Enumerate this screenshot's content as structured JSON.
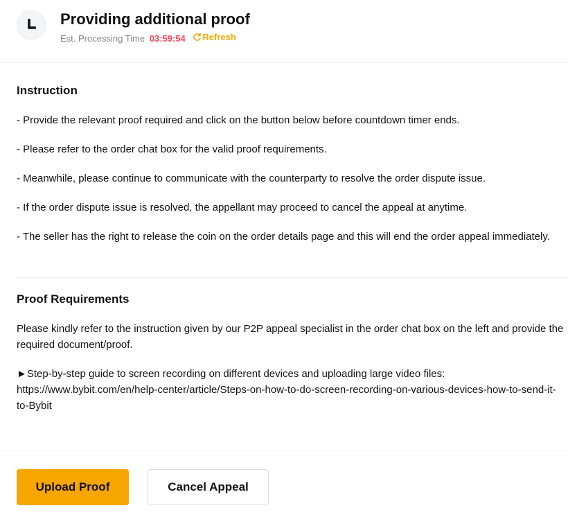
{
  "header": {
    "title": "Providing additional proof",
    "processing_label": "Est. Processing Time",
    "timer": "03:59:54",
    "refresh_label": "Refresh",
    "clock_icon": "clock-icon",
    "refresh_icon": "refresh-icon"
  },
  "instruction": {
    "title": "Instruction",
    "items": [
      "- Provide the relevant proof required and click on the button below before countdown timer ends.",
      "- Please refer to the order chat box for the valid proof requirements.",
      "- Meanwhile, please continue to communicate with the counterparty to resolve the order dispute issue.",
      "- If the order dispute issue is resolved, the appellant may proceed to cancel the appeal at anytime.",
      "- The seller has the right to release the coin on the order details page and this will end the order appeal immediately."
    ]
  },
  "proof": {
    "title": "Proof Requirements",
    "text": "Please kindly refer to the instruction given by our P2P appeal specialist in the order chat box on the left and provide the required document/proof.",
    "guide_label": "►Step-by-step guide to screen recording on different devices and uploading large video files:",
    "guide_url": "https://www.bybit.com/en/help-center/article/Steps-on-how-to-do-screen-recording-on-various-devices-how-to-send-it-to-Bybit"
  },
  "actions": {
    "upload_label": "Upload Proof",
    "cancel_label": "Cancel Appeal"
  },
  "colors": {
    "accent": "#f7a600",
    "timer": "#f6465d",
    "muted": "#81858c",
    "text": "#121214"
  }
}
